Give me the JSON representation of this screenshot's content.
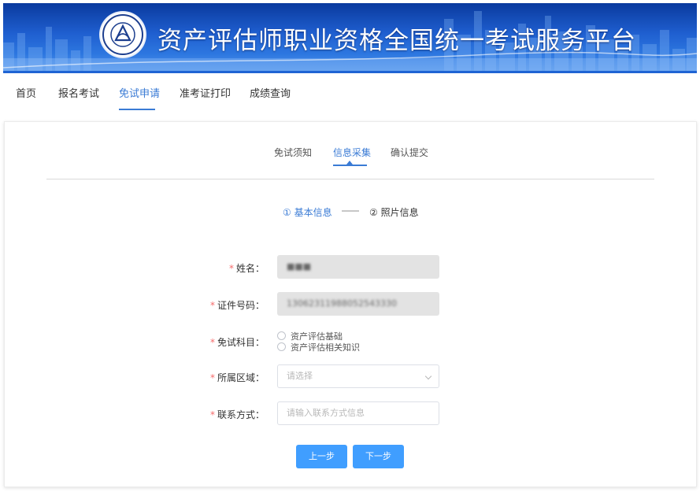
{
  "header": {
    "title": "资产评估师职业资格全国统一考试服务平台",
    "logo_icon": "association-seal-icon"
  },
  "nav": {
    "items": [
      {
        "label": "首页"
      },
      {
        "label": "报名考试"
      },
      {
        "label": "免试申请"
      },
      {
        "label": "准考证打印"
      },
      {
        "label": "成绩查询"
      }
    ],
    "active_index": 2
  },
  "subtabs": {
    "items": [
      {
        "label": "免试须知"
      },
      {
        "label": "信息采集"
      },
      {
        "label": "确认提交"
      }
    ],
    "active_index": 1
  },
  "steps": {
    "step1": "① 基本信息",
    "step2": "② 照片信息"
  },
  "form": {
    "name": {
      "label": "姓名：",
      "value": "■■■"
    },
    "id_number": {
      "label": "证件号码：",
      "value": "13062311988052543330"
    },
    "subjects": {
      "label": "免试科目：",
      "options": [
        "资产评估基础",
        "资产评估相关知识"
      ]
    },
    "region": {
      "label": "所属区域：",
      "placeholder": "请选择"
    },
    "contact": {
      "label": "联系方式：",
      "placeholder": "请输入联系方式信息"
    }
  },
  "buttons": {
    "prev": "上一步",
    "next": "下一步"
  },
  "colors": {
    "accent": "#3a7bd5",
    "button": "#409eff",
    "required": "#f56c6c",
    "banner": "#1f5fd0"
  }
}
